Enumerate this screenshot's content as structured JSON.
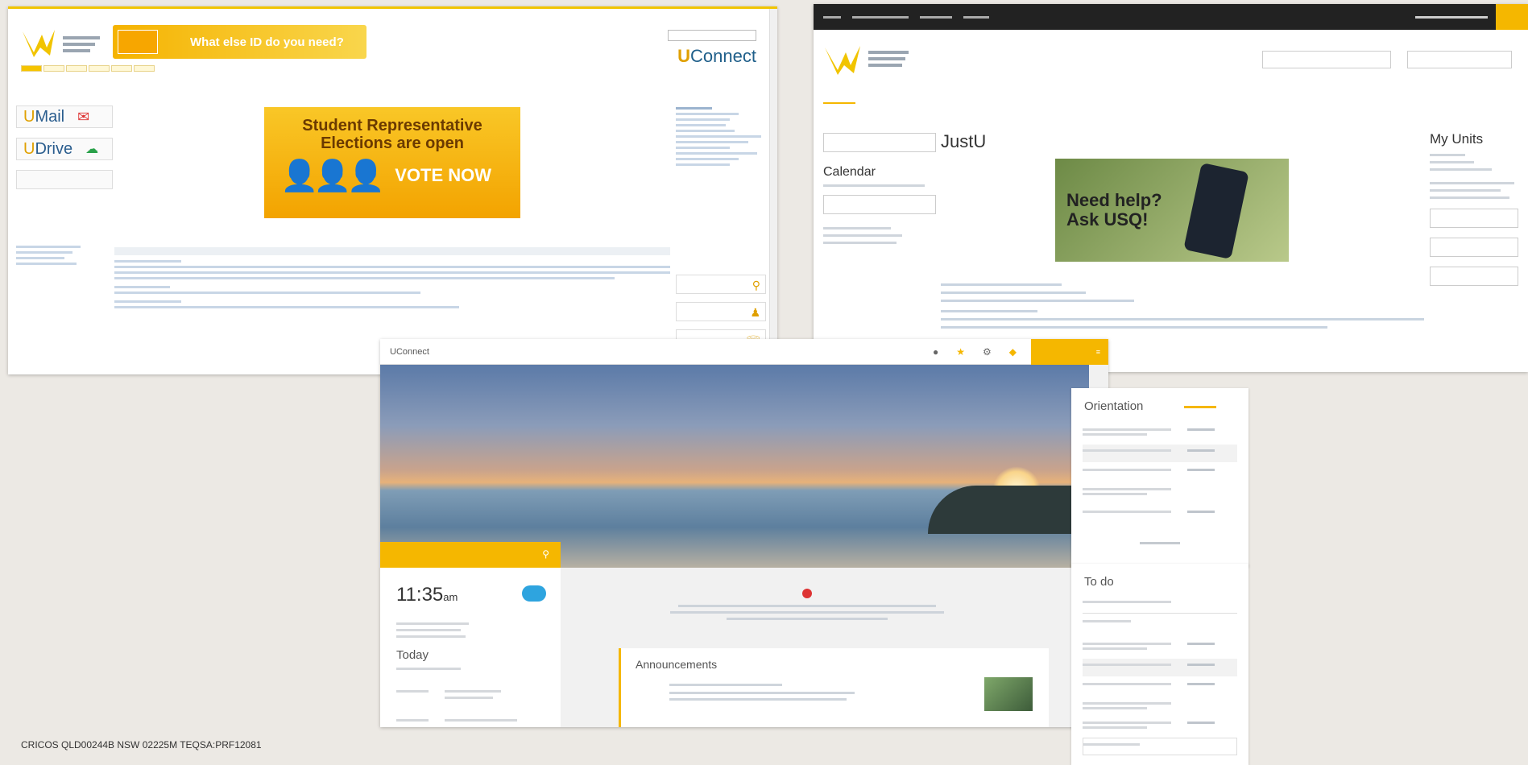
{
  "footer": {
    "cricos": "CRICOS QLD00244B NSW 02225M TEQSA:PRF12081"
  },
  "old_portal": {
    "banner_title": "What else ID do you need?",
    "brand_u": "U",
    "brand_rest": "Connect",
    "umail_u": "U",
    "umail_rest": "Mail",
    "udrive_u": "U",
    "udrive_rest": "Drive",
    "vote_title_1": "Student Representative",
    "vote_title_2": "Elections are open",
    "vote_cta": "VOTE NOW"
  },
  "usq_portal": {
    "page_title": "JustU",
    "help_line_1": "Need help?",
    "help_line_2": "Ask USQ!",
    "calendar_heading": "Calendar",
    "my_units_heading": "My Units"
  },
  "new_uconnect": {
    "app_title": "UConnect",
    "clock_time": "11:35",
    "clock_meridiem": "am",
    "today_heading": "Today",
    "announcements_heading": "Announcements",
    "orientation_heading": "Orientation",
    "todo_heading": "To do"
  },
  "colors": {
    "accent": "#f5b700",
    "link": "#2a5d8e",
    "dark_bar": "#222222"
  }
}
